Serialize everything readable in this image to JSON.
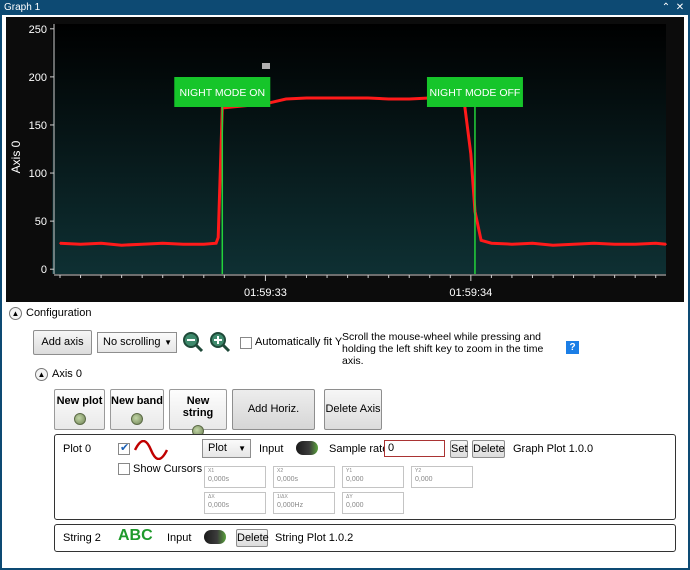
{
  "window": {
    "title": "Graph 1",
    "buttons": {
      "collapse": "⌃",
      "close": "✕"
    }
  },
  "chart_data": {
    "type": "line",
    "ylabel": "Axis 0",
    "ylim": [
      -5,
      255
    ],
    "yticks": [
      0,
      50,
      100,
      150,
      200,
      250
    ],
    "xtick_labels": [
      "01:59:33",
      "01:59:34"
    ],
    "series": [
      {
        "name": "",
        "color": "#ff1a1a",
        "x": [
          0.0,
          0.1,
          0.2,
          0.3,
          0.4,
          0.5,
          0.6,
          0.7,
          0.76,
          0.77,
          0.79,
          0.8,
          0.9,
          1.0,
          1.1,
          1.2,
          1.3,
          1.4,
          1.5,
          1.6,
          1.7,
          1.8,
          1.9,
          1.95,
          1.97,
          2.0,
          2.02,
          2.05,
          2.1,
          2.2,
          2.3,
          2.4,
          2.5,
          2.6,
          2.7,
          2.8,
          2.9,
          2.95
        ],
        "y": [
          27,
          26,
          27,
          25,
          26,
          27,
          26,
          26,
          27,
          33,
          168,
          168,
          170,
          172,
          177,
          178,
          178,
          178,
          178,
          177,
          177,
          178,
          178,
          178,
          170,
          120,
          60,
          30,
          27,
          26,
          27,
          25,
          26,
          27,
          26,
          26,
          27,
          26
        ]
      }
    ],
    "markers": [
      {
        "label": "NIGHT MODE ON",
        "x": 0.79
      },
      {
        "label": "NIGHT MODE OFF",
        "x": 2.02
      }
    ],
    "colors": {
      "background_top": "#000000",
      "background_bottom": "#0e3033",
      "marker_box": "#16c52a",
      "marker_line": "#23d23a",
      "trace": "#ff1a1a",
      "cursor_handle": "#b0b0b0"
    }
  },
  "config": {
    "header": "Configuration",
    "add_axis": "Add axis",
    "scroll_mode": "No scrolling",
    "auto_fit": "Automatically fit Y",
    "hint": "Scroll the mouse-wheel while pressing and holding the left shift key to zoom in the time axis.",
    "help": "?"
  },
  "axis": {
    "header": "Axis 0",
    "new_plot": "New plot",
    "new_band": "New band",
    "new_string": "New string",
    "add_cursor": "Add Horiz. Cursor",
    "delete_axis": "Delete Axis"
  },
  "plot0": {
    "name": "Plot 0",
    "type": "Plot",
    "input": "Input",
    "sample_rate_label": "Sample rate",
    "sample_rate_value": "0",
    "set": "Set",
    "delete": "Delete",
    "version": "Graph Plot 1.0.0",
    "show_cursors": "Show Cursors",
    "stats": [
      {
        "cap": "X1",
        "val": "0,000s"
      },
      {
        "cap": "X2",
        "val": "0,000s"
      },
      {
        "cap": "Y1",
        "val": "0,000"
      },
      {
        "cap": "Y2",
        "val": "0,000"
      },
      {
        "cap": "ΔX",
        "val": "0,000s"
      },
      {
        "cap": "1/ΔX",
        "val": "0,000Hz"
      },
      {
        "cap": "ΔY",
        "val": "0,000"
      }
    ]
  },
  "string2": {
    "name": "String 2",
    "abc": "ABC",
    "input": "Input",
    "delete": "Delete",
    "version": "String Plot 1.0.2"
  }
}
